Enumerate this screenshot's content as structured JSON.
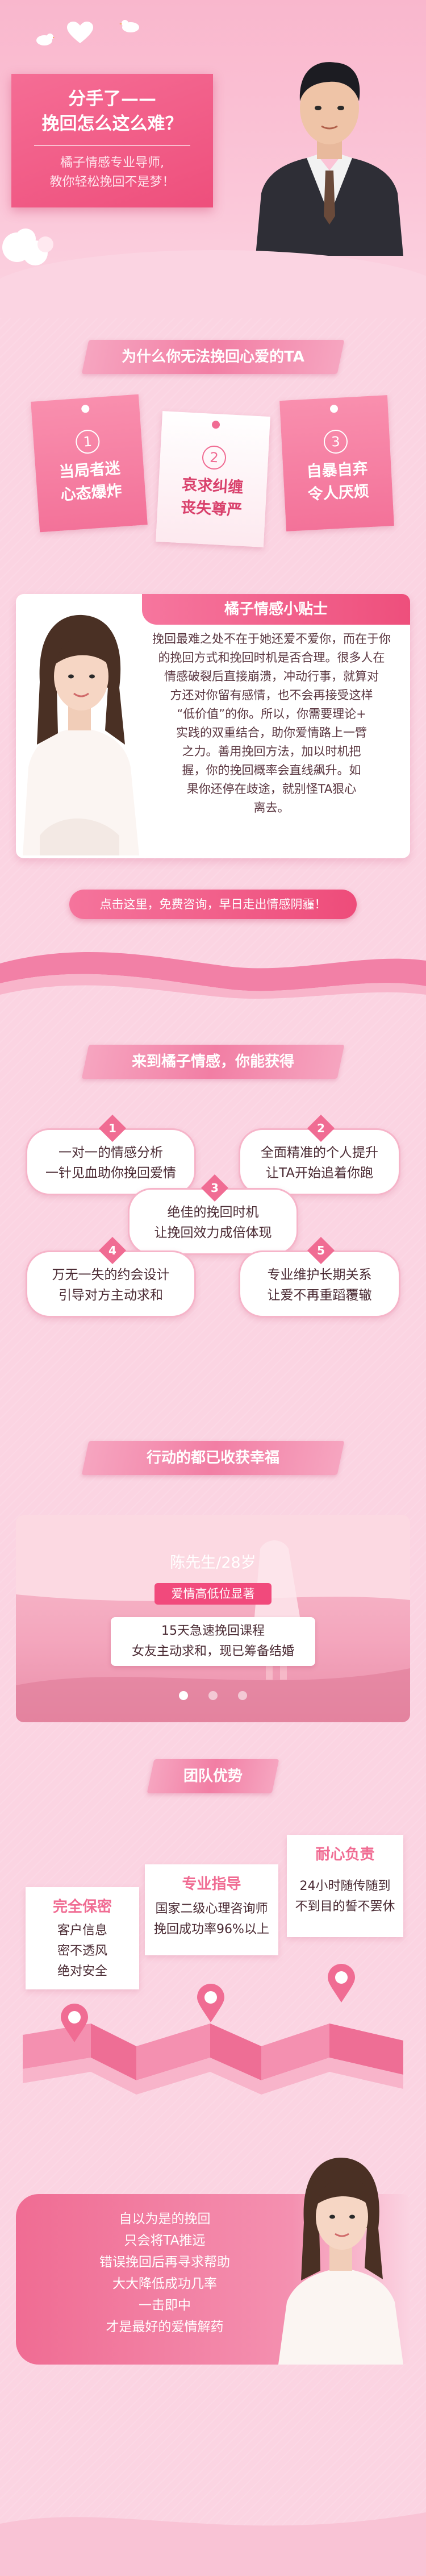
{
  "hero": {
    "title_line1": "分手了——",
    "title_line2": "挽回怎么这么难？",
    "sub_line1": "橘子情感专业导师,",
    "sub_line2": "教你轻松挽回不是梦！"
  },
  "why": {
    "banner": "为什么你无法挽回心爱的TA",
    "cards": [
      {
        "num": "1",
        "line1": "当局者迷",
        "line2": "心态爆炸"
      },
      {
        "num": "2",
        "line1": "哀求纠缠",
        "line2": "丧失尊严"
      },
      {
        "num": "3",
        "line1": "自暴自弃",
        "line2": "令人厌烦"
      }
    ]
  },
  "tips": {
    "title": "橘子情感小贴士",
    "lines": [
      "挽回最难之处不在于她还爱不爱你，而在于你",
      "的挽回方式和挽回时机是否合理。很多人在",
      "情感破裂后直接崩溃，冲动行事，就算对",
      "方还对你留有感情，也不会再接受这样",
      "“低价值”的你。所以，你需要理论+",
      "实践的双重结合，助你爱情路上一臂",
      "之力。善用挽回方法，加以时机把",
      "握，你的挽回概率会直线飙升。如",
      "果你还停在歧途，就别怪TA狠心",
      "离去。"
    ],
    "cta": "点击这里，免费咨询，早日走出情感阴霾！"
  },
  "gains": {
    "banner": "来到橘子情感，你能获得",
    "items": [
      {
        "num": "1",
        "line1": "一对一的情感分析",
        "line2": "一针见血助你挽回爱情"
      },
      {
        "num": "2",
        "line1": "全面精准的个人提升",
        "line2": "让TA开始追着你跑"
      },
      {
        "num": "3",
        "line1": "绝佳的挽回时机",
        "line2": "让挽回效力成倍体现"
      },
      {
        "num": "4",
        "line1": "万无一失的约会设计",
        "line2": "引导对方主动求和"
      },
      {
        "num": "5",
        "line1": "专业维护长期关系",
        "line2": "让爱不再重蹈覆辙"
      }
    ]
  },
  "story": {
    "banner": "行动的都已收获幸福",
    "name": "陈先生/28岁",
    "tag": "爱情高低位显著",
    "line1": "15天急速挽回课程",
    "line2": "女友主动求和，现已筹备结婚"
  },
  "team": {
    "banner": "团队优势",
    "cards": [
      {
        "head": "完全保密",
        "lines": [
          "客户信息",
          "密不透风",
          "绝对安全"
        ]
      },
      {
        "head": "专业指导",
        "lines": [
          "国家二级心理咨询师",
          "挽回成功率96%以上"
        ]
      },
      {
        "head": "耐心负责",
        "lines": [
          "24小时随传随到",
          "不到目的誓不罢休"
        ]
      }
    ]
  },
  "final": {
    "lines": [
      "自以为是的挽回",
      "只会将TA推远",
      "错误挽回后再寻求帮助",
      "大大降低成功几率",
      "一击即中",
      "才是最好的爱情解药"
    ]
  },
  "colors": {
    "primary": "#f06c93",
    "deep": "#ee4f7c",
    "background": "#fbd4e2"
  }
}
